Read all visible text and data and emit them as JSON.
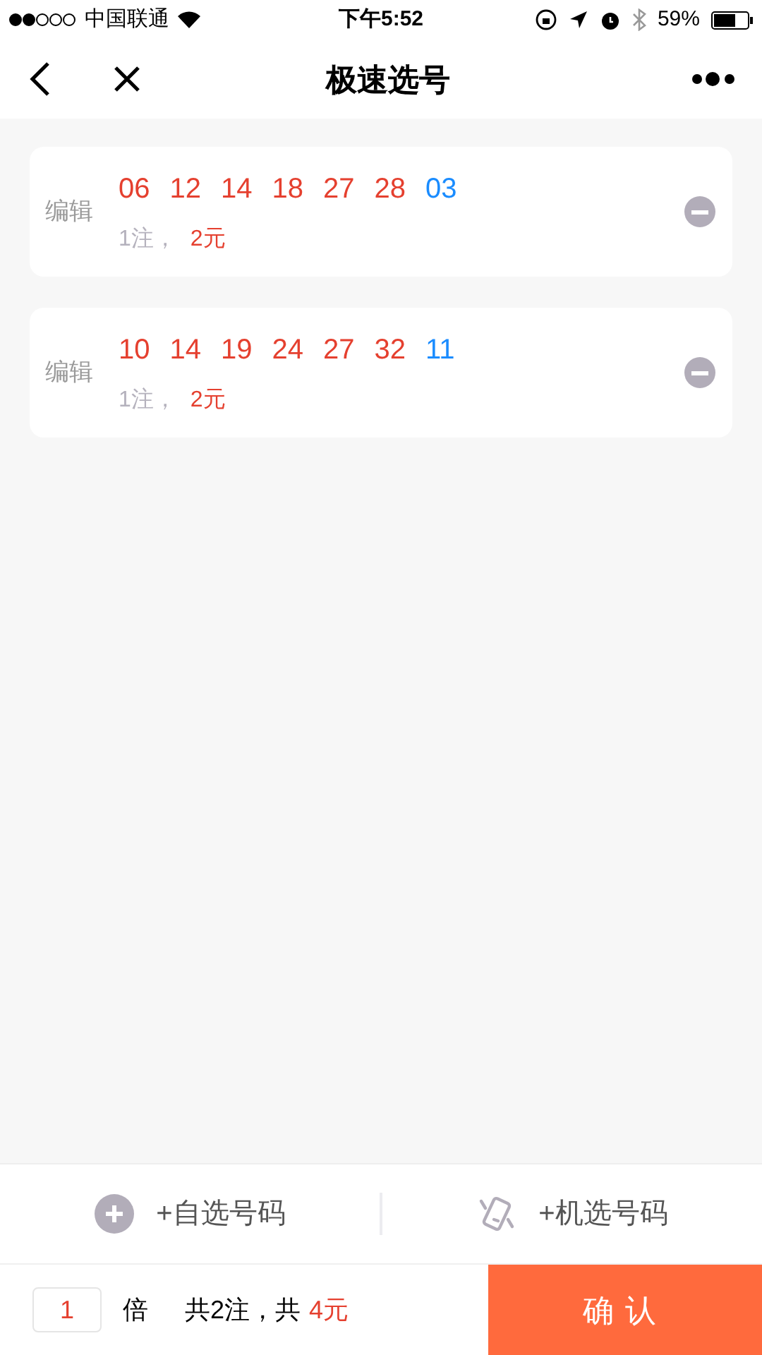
{
  "status_bar": {
    "carrier": "中国联通",
    "time": "下午5:52",
    "battery": "59%"
  },
  "nav": {
    "title": "极速选号"
  },
  "tickets": [
    {
      "edit": "编辑",
      "numbers": [
        {
          "text": "06",
          "kind": "front"
        },
        {
          "text": "12",
          "kind": "front"
        },
        {
          "text": "14",
          "kind": "front"
        },
        {
          "text": "18",
          "kind": "front"
        },
        {
          "text": "27",
          "kind": "front"
        },
        {
          "text": "28",
          "kind": "front"
        },
        {
          "text": "03",
          "kind": "back"
        }
      ],
      "count": "1注，",
      "price": "2元"
    },
    {
      "edit": "编辑",
      "numbers": [
        {
          "text": "10",
          "kind": "front"
        },
        {
          "text": "14",
          "kind": "front"
        },
        {
          "text": "19",
          "kind": "front"
        },
        {
          "text": "24",
          "kind": "front"
        },
        {
          "text": "27",
          "kind": "front"
        },
        {
          "text": "32",
          "kind": "front"
        },
        {
          "text": "11",
          "kind": "back"
        }
      ],
      "count": "1注，",
      "price": "2元"
    }
  ],
  "actions": [
    {
      "label": "+自选号码",
      "kind": "manual"
    },
    {
      "label": "+机选号码",
      "kind": "random"
    }
  ],
  "footer": {
    "multiplier": "1",
    "multiplier_unit": "倍",
    "summary": "共2注，共",
    "total": "4元",
    "confirm": "确认"
  }
}
